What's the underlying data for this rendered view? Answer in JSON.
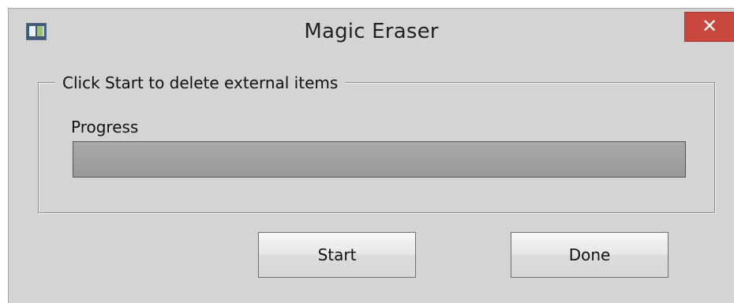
{
  "window": {
    "title": "Magic Eraser",
    "close_symbol": "✕"
  },
  "group": {
    "legend": "Click Start to delete external items"
  },
  "progress": {
    "label": "Progress",
    "value_percent": 0
  },
  "buttons": {
    "start_label": "Start",
    "done_label": "Done"
  },
  "icons": {
    "app": "app-window-icon",
    "close": "close-icon"
  },
  "colors": {
    "close_button": "#c9473f",
    "window_background": "#d4d4d4"
  }
}
